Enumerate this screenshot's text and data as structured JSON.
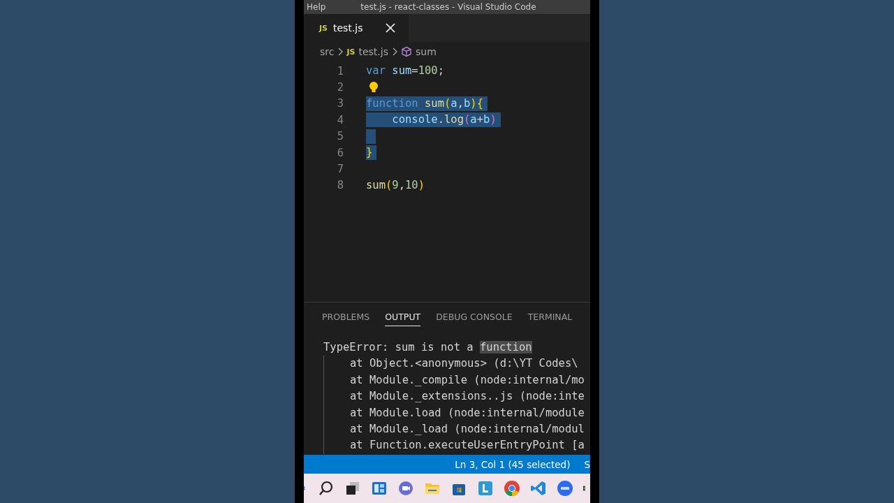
{
  "title_bar": {
    "menu": "Help",
    "title": "test.js - react-classes - Visual Studio Code"
  },
  "tabs": [
    {
      "label": "test.js",
      "badge": "JS",
      "selected": true
    }
  ],
  "breadcrumbs": {
    "folder": "src",
    "file_badge": "JS",
    "file": "test.js",
    "symbol": "sum"
  },
  "code_lines": [
    {
      "number": "1",
      "selected": false,
      "tokens": [
        {
          "text": "var",
          "kind": "keyword"
        },
        {
          "text": " sum",
          "kind": "variable"
        },
        {
          "text": "=",
          "kind": "plain"
        },
        {
          "text": "100",
          "kind": "number"
        },
        {
          "text": ";",
          "kind": "plain"
        }
      ]
    },
    {
      "number": "2",
      "selected": false,
      "lightbulb": true
    },
    {
      "number": "3",
      "selected": true,
      "tokens": [
        {
          "text": "function",
          "kind": "keyword"
        },
        {
          "text": " sum",
          "kind": "function"
        },
        {
          "text": "(",
          "kind": "bracket"
        },
        {
          "text": "a",
          "kind": "variable"
        },
        {
          "text": ",",
          "kind": "plain"
        },
        {
          "text": "b",
          "kind": "variable"
        },
        {
          "text": ")",
          "kind": "bracket"
        },
        {
          "text": "{",
          "kind": "bracket"
        }
      ]
    },
    {
      "number": "4",
      "selected": true,
      "tokens": [
        {
          "text": "    console",
          "kind": "variable"
        },
        {
          "text": ".",
          "kind": "plain"
        },
        {
          "text": "log",
          "kind": "function"
        },
        {
          "text": "(",
          "kind": "bracket2"
        },
        {
          "text": "a",
          "kind": "variable"
        },
        {
          "text": "+",
          "kind": "plain"
        },
        {
          "text": "b",
          "kind": "variable"
        },
        {
          "text": ")",
          "kind": "bracket2"
        }
      ]
    },
    {
      "number": "5",
      "selected": true
    },
    {
      "number": "6",
      "selected": true,
      "tokens": [
        {
          "text": "}",
          "kind": "bracket"
        }
      ]
    },
    {
      "number": "7",
      "selected": false
    },
    {
      "number": "8",
      "selected": false,
      "tokens": [
        {
          "text": "sum",
          "kind": "function"
        },
        {
          "text": "(",
          "kind": "bracket"
        },
        {
          "text": "9",
          "kind": "number"
        },
        {
          "text": ",",
          "kind": "plain"
        },
        {
          "text": "10",
          "kind": "number"
        },
        {
          "text": ")",
          "kind": "bracket"
        }
      ]
    }
  ],
  "panel_tabs": [
    {
      "label": "PROBLEMS",
      "selected": false
    },
    {
      "label": "OUTPUT",
      "selected": true
    },
    {
      "label": "DEBUG CONSOLE",
      "selected": false
    },
    {
      "label": "TERMINAL",
      "selected": false
    }
  ],
  "output": {
    "error_parts": [
      {
        "text": "TypeError: sum is not a ",
        "highlighted": false
      },
      {
        "text": "function",
        "highlighted": true
      }
    ],
    "stack": [
      "at Object.<anonymous> (d:\\YT Codes\\",
      "at Module._compile (node:internal/mo",
      "at Module._extensions..js (node:inte",
      "at Module.load (node:internal/module",
      "at Module._load (node:internal/modul",
      "at Function.executeUserEntryPoint [a"
    ]
  },
  "status_bar": {
    "position": "Ln 3, Col 1 (45 selected)",
    "item_2": "S"
  }
}
